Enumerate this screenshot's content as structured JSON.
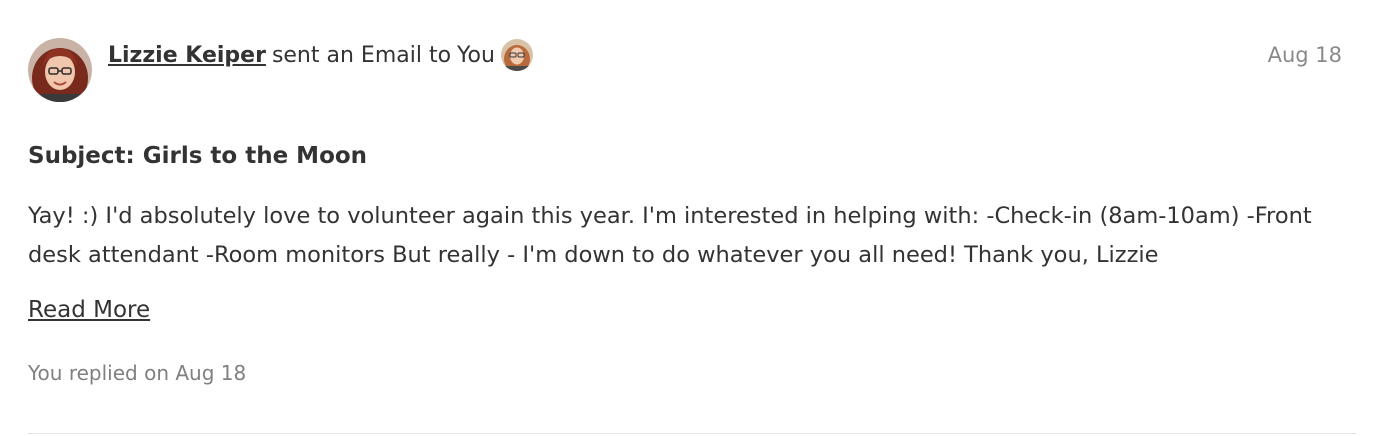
{
  "sender": {
    "name": "Lizzie Keiper",
    "avatar_icon": "sender-avatar"
  },
  "activity": {
    "action_text": "sent an Email to",
    "recipient": "You",
    "recipient_avatar_icon": "recipient-avatar"
  },
  "date": "Aug 18",
  "email": {
    "subject": "Subject: Girls to the Moon",
    "body": "Yay! :) I'd absolutely love to volunteer again this year. I'm interested in helping with: -Check-in (8am-10am) -Front desk attendant -Room monitors But really - I'm down to do whatever you all need! Thank you, Lizzie",
    "read_more_label": "Read More"
  },
  "reply_status": "You replied on Aug 18",
  "colors": {
    "text": "#333333",
    "muted": "#8a8a8a",
    "divider": "#e3e3e3"
  }
}
